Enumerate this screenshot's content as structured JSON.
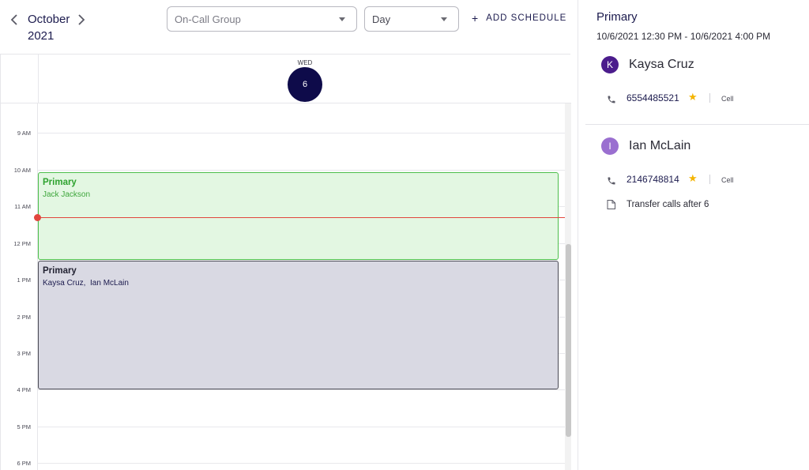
{
  "header": {
    "month": "October",
    "year": "2021",
    "group_placeholder": "On-Call Group",
    "view_value": "Day",
    "add_schedule_label": "ADD SCHEDULE"
  },
  "day": {
    "weekday": "WED",
    "date": "6"
  },
  "hours": [
    "9 AM",
    "10 AM",
    "11 AM",
    "12 PM",
    "1 PM",
    "2 PM",
    "3 PM",
    "4 PM",
    "5 PM",
    "6 PM"
  ],
  "events": [
    {
      "title": "Primary",
      "people": "Jack Jackson",
      "color": "#4cbe4b"
    },
    {
      "title": "Primary",
      "people": "Kaysa Cruz,  Ian McLain",
      "color": "#4a4a55"
    }
  ],
  "details": {
    "title": "Primary",
    "range": "10/6/2021 12:30 PM - 10/6/2021 4:00 PM",
    "people": [
      {
        "initial": "K",
        "name": "Kaysa Cruz",
        "phone": "6554485521",
        "type": "Cell",
        "avatar_color": "#4b1c8c"
      },
      {
        "initial": "I",
        "name": "Ian McLain",
        "phone": "2146748814",
        "type": "Cell",
        "note": "Transfer calls after 6",
        "avatar_color": "#9a6fd0"
      }
    ]
  },
  "icons": {
    "prev": "chevron-left-icon",
    "next": "chevron-right-icon",
    "add": "plus-icon",
    "phone": "phone-icon",
    "star": "star-icon",
    "note": "note-icon"
  },
  "colors": {
    "accent": "#0e0b4a",
    "now_line": "#e2463d",
    "star": "#f4b400"
  }
}
